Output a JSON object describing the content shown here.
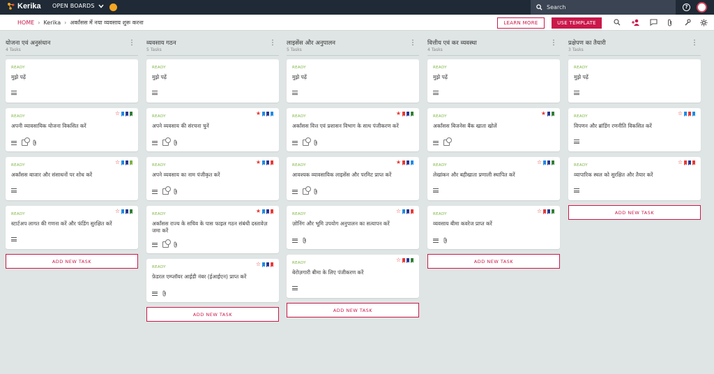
{
  "app": {
    "logo": "Kerika",
    "open_boards": "OPEN BOARDS",
    "search_placeholder": "Search"
  },
  "breadcrumb": {
    "home": "HOME",
    "org": "Kerika",
    "board": "अर्कांसस में नया व्यवसाय शुरू करना"
  },
  "toolbar": {
    "learn_more": "LEARN MORE",
    "use_template": "USE TEMPLATE"
  },
  "colors": {
    "accent": "#c9184a",
    "ready": "#7cb342",
    "red": "#e53935",
    "blue": "#1e88e5",
    "navy": "#283593",
    "green": "#2e7d32",
    "lightgreen": "#7cb342"
  },
  "add_task_label": "ADD NEW TASK",
  "columns": [
    {
      "title": "योजना एवं अनुसंधान",
      "count": "4 Tasks",
      "cards": [
        {
          "status": "READY",
          "title": "मुझे पढ़ें",
          "star": "",
          "flags": [],
          "icons": [
            "desc"
          ]
        },
        {
          "status": "READY",
          "title": "अपनी व्यावसायिक योजना विकसित करें",
          "star": "outline",
          "flags": [
            "blue",
            "navy",
            "green"
          ],
          "icons": [
            "desc",
            "check",
            "clip"
          ]
        },
        {
          "status": "READY",
          "title": "अर्कांसस बाजार और संसाधनों पर शोध करें",
          "star": "outline",
          "flags": [
            "blue",
            "navy",
            "lightgreen"
          ],
          "icons": [
            "desc"
          ]
        },
        {
          "status": "READY",
          "title": "स्टार्टअप लागत की गणना करें और फंडिंग सुरक्षित करें",
          "star": "outline",
          "flags": [
            "blue",
            "navy",
            "green"
          ],
          "icons": [
            "desc"
          ]
        }
      ]
    },
    {
      "title": "व्यवसाय गठन",
      "count": "5 Tasks",
      "cards": [
        {
          "status": "READY",
          "title": "मुझे पढ़ें",
          "star": "",
          "flags": [],
          "icons": [
            "desc"
          ]
        },
        {
          "status": "READY",
          "title": "अपने व्यवसाय की संरचना चुनें",
          "star": "filled",
          "flags": [
            "blue",
            "navy",
            "blue"
          ],
          "icons": [
            "desc",
            "check",
            "clip"
          ]
        },
        {
          "status": "READY",
          "title": "अपने व्यवसाय का नाम पंजीकृत करें",
          "star": "filled",
          "flags": [
            "blue",
            "navy",
            "red"
          ],
          "icons": [
            "desc",
            "check",
            "clip"
          ]
        },
        {
          "status": "READY",
          "title": "अर्कांसस राज्य के सचिव के पास फाइल गठन संबंधी दस्तावेज़ जमा करें",
          "star": "filled",
          "flags": [
            "blue",
            "navy",
            "red"
          ],
          "icons": [
            "desc",
            "check",
            "clip"
          ]
        },
        {
          "status": "READY",
          "title": "फ़ेडरल एम्प्लॉयर आईडी नंबर (ईआईएन) प्राप्त करें",
          "star": "outline",
          "flags": [
            "blue",
            "navy",
            "red"
          ],
          "icons": [
            "desc",
            "clip"
          ]
        }
      ]
    },
    {
      "title": "लाइसेंस और अनुपालन",
      "count": "5 Tasks",
      "cards": [
        {
          "status": "READY",
          "title": "मुझे पढ़ें",
          "star": "",
          "flags": [],
          "icons": [
            "desc"
          ]
        },
        {
          "status": "READY",
          "title": "अर्कांसस वित्त एवं प्रशासन विभाग के साथ पंजीकरण करें",
          "star": "filled",
          "flags": [
            "red",
            "navy",
            "green"
          ],
          "icons": [
            "desc",
            "check",
            "clip"
          ]
        },
        {
          "status": "READY",
          "title": "आवश्यक व्यावसायिक लाइसेंस और परमिट प्राप्त करें",
          "star": "filled",
          "flags": [
            "red",
            "navy",
            "blue"
          ],
          "icons": [
            "desc",
            "check",
            "clip"
          ]
        },
        {
          "status": "READY",
          "title": "ज़ोनिंग और भूमि उपयोग अनुपालन का सत्यापन करें",
          "star": "outline",
          "flags": [
            "blue",
            "navy",
            "red"
          ],
          "icons": [
            "desc",
            "clip"
          ]
        },
        {
          "status": "READY",
          "title": "बेरोज़गारी बीमा के लिए पंजीकरण करें",
          "star": "outline",
          "flags": [
            "red",
            "navy",
            "green"
          ],
          "icons": [
            "desc"
          ]
        }
      ]
    },
    {
      "title": "वित्तीय एवं कर व्यवस्था",
      "count": "4 Tasks",
      "cards": [
        {
          "status": "READY",
          "title": "मुझे पढ़ें",
          "star": "",
          "flags": [],
          "icons": [
            "desc"
          ]
        },
        {
          "status": "READY",
          "title": "अर्कांसस बिजनेस बैंक खाता खोलें",
          "star": "filled",
          "flags": [
            "navy",
            "green"
          ],
          "icons": [
            "desc",
            "check"
          ]
        },
        {
          "status": "READY",
          "title": "लेखांकन और बहीखाता प्रणाली स्थापित करें",
          "star": "outline",
          "flags": [
            "blue",
            "navy",
            "green"
          ],
          "icons": [
            "desc"
          ]
        },
        {
          "status": "READY",
          "title": "व्यवसाय बीमा कवरेज प्राप्त करें",
          "star": "outline",
          "flags": [
            "red",
            "navy",
            "green"
          ],
          "icons": [
            "desc",
            "clip"
          ]
        }
      ]
    },
    {
      "title": "प्रक्षेपण का तैयारी",
      "count": "3 Tasks",
      "cards": [
        {
          "status": "READY",
          "title": "मुझे पढ़ें",
          "star": "",
          "flags": [],
          "icons": [
            "desc"
          ]
        },
        {
          "status": "READY",
          "title": "विपणन और ब्रांडिंग रणनीति विकसित करें",
          "star": "outline",
          "flags": [
            "blue",
            "red",
            "blue"
          ],
          "icons": [
            "desc"
          ]
        },
        {
          "status": "READY",
          "title": "व्यापारिक स्थल को सुरक्षित और तैयार करें",
          "star": "outline",
          "flags": [
            "red",
            "navy",
            "red"
          ],
          "icons": [
            "desc"
          ]
        }
      ]
    }
  ]
}
